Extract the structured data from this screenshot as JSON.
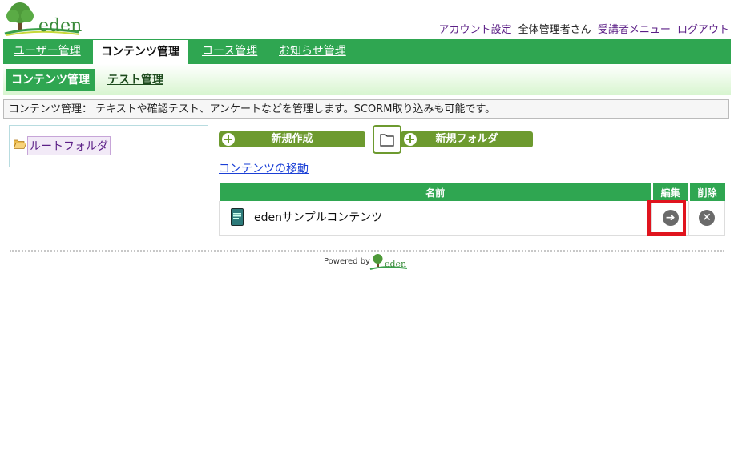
{
  "header": {
    "logo_text": "eden",
    "account_link": "アカウント設定",
    "user_name": "全体管理者さん",
    "learner_menu_link": "受講者メニュー",
    "logout_link": "ログアウト"
  },
  "main_nav": {
    "tabs": [
      {
        "label": "ユーザー管理",
        "active": false
      },
      {
        "label": "コンテンツ管理",
        "active": true
      },
      {
        "label": "コース管理",
        "active": false
      },
      {
        "label": "お知らせ管理",
        "active": false
      }
    ]
  },
  "sub_nav": {
    "tabs": [
      {
        "label": "コンテンツ管理",
        "active": true
      },
      {
        "label": "テスト管理",
        "active": false
      }
    ]
  },
  "description": "コンテンツ管理： テキストや確認テスト、アンケートなどを管理します。SCORM取り込みも可能です。",
  "folder_tree": {
    "root_label": "ルートフォルダ",
    "icon": "folder-open-icon"
  },
  "actions": {
    "new_create_label": "新規作成",
    "new_folder_label": "新規フォルダ",
    "move_contents_label": "コンテンツの移動"
  },
  "table": {
    "headers": {
      "name": "名前",
      "edit": "編集",
      "delete": "削除"
    },
    "rows": [
      {
        "name": "edenサンプルコンテンツ",
        "icon": "book-icon",
        "edit_icon": "arrow-right-circle-icon",
        "delete_icon": "close-circle-icon"
      }
    ]
  },
  "footer": {
    "powered_by": "Powered by",
    "logo_text": "eden"
  },
  "colors": {
    "nav_green": "#2fa651",
    "button_green": "#6d9a2f",
    "highlight_red": "#e0141e"
  }
}
